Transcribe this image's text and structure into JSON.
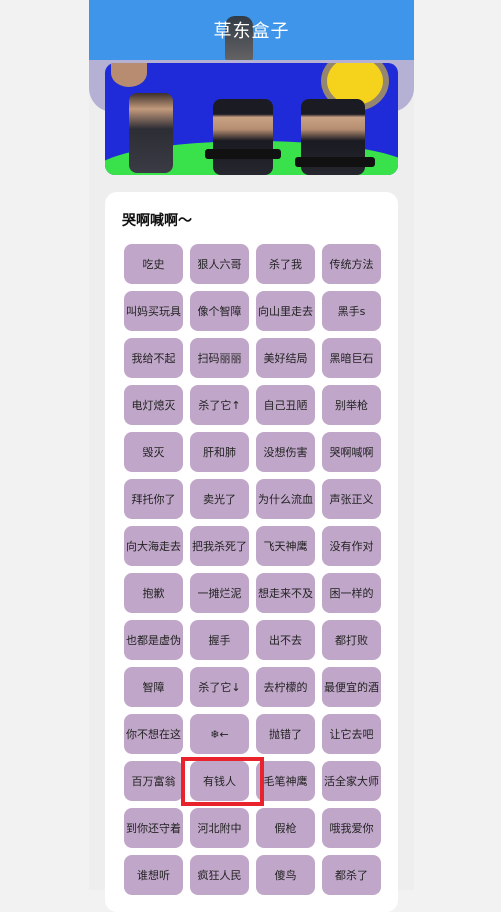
{
  "header": {
    "title": "草东盒子"
  },
  "section": {
    "title": "哭啊喊啊～"
  },
  "buttons": [
    "吃史",
    "狠人六哥",
    "杀了我",
    "传统方法",
    "叫妈买玩具",
    "像个智障",
    "向山里走去",
    "黑手s",
    "我给不起",
    "扫码丽丽",
    "美好结局",
    "黑暗巨石",
    "电灯熄灭",
    "杀了它↑",
    "自己丑陋",
    "别举枪",
    "毁灭",
    "肝和肺",
    "没想伤害",
    "哭啊喊啊",
    "拜托你了",
    "卖光了",
    "为什么流血",
    "声张正义",
    "向大海走去",
    "把我杀死了",
    "飞天神鹰",
    "没有作对",
    "抱歉",
    "一摊烂泥",
    "想走来不及",
    "困一样的",
    "也都是虚伪",
    "握手",
    "出不去",
    "都打败",
    "智障",
    "杀了它↓",
    "去柠檬的",
    "最便宜的酒",
    "你不想在这",
    "❄←",
    "抛错了",
    "让它去吧",
    "百万富翁",
    "有钱人",
    "毛笔神鹰",
    "活全家大师",
    "到你还守着",
    "河北附中",
    "假枪",
    "哦我爱你",
    "谁想听",
    "疯狂人民",
    "傻鸟",
    "都杀了"
  ],
  "colors": {
    "header": "#3f95ea",
    "button": "#c0a7c9",
    "highlight": "#e8232c"
  }
}
